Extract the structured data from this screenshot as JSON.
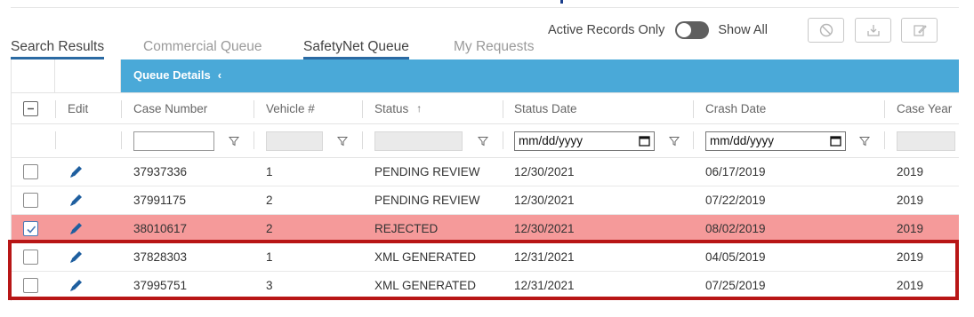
{
  "tabs": [
    {
      "label": "Search Results",
      "active": true
    },
    {
      "label": "Commercial Queue",
      "active": false
    },
    {
      "label": "SafetyNet Queue",
      "active": true
    },
    {
      "label": "My Requests",
      "active": false
    }
  ],
  "toolbar": {
    "active_only_label": "Active Records Only",
    "show_all_label": "Show All",
    "buttons": [
      "block-icon",
      "download-icon",
      "edit-icon"
    ]
  },
  "grid": {
    "panel_label": "Queue Details",
    "columns": {
      "edit": "Edit",
      "case_number": "Case Number",
      "vehicle": "Vehicle #",
      "status": "Status",
      "status_date": "Status Date",
      "crash_date": "Crash Date",
      "case_year": "Case Year"
    },
    "sort_indicator": "↑",
    "filters": {
      "status_date_placeholder": "mm/dd/yyyy",
      "crash_date_placeholder": "mm/dd/yyyy"
    },
    "rows": [
      {
        "case_number": "37937336",
        "vehicle": "1",
        "status": "PENDING REVIEW",
        "status_date": "12/30/2021",
        "crash_date": "06/17/2019",
        "case_year": "2019",
        "checked": false,
        "highlight": ""
      },
      {
        "case_number": "37991175",
        "vehicle": "2",
        "status": "PENDING REVIEW",
        "status_date": "12/30/2021",
        "crash_date": "07/22/2019",
        "case_year": "2019",
        "checked": false,
        "highlight": ""
      },
      {
        "case_number": "38010617",
        "vehicle": "2",
        "status": "REJECTED",
        "status_date": "12/30/2021",
        "crash_date": "08/02/2019",
        "case_year": "2019",
        "checked": true,
        "highlight": "#f59a9a"
      },
      {
        "case_number": "37828303",
        "vehicle": "1",
        "status": "XML GENERATED",
        "status_date": "12/31/2021",
        "crash_date": "04/05/2019",
        "case_year": "2019",
        "checked": false,
        "highlight": ""
      },
      {
        "case_number": "37995751",
        "vehicle": "3",
        "status": "XML GENERATED",
        "status_date": "12/31/2021",
        "crash_date": "07/25/2019",
        "case_year": "2019",
        "checked": false,
        "highlight": ""
      }
    ]
  },
  "colors": {
    "accent_blue": "#4aa9d8",
    "tab_underline": "#2b6aa3",
    "rejected_row": "#f59a9a",
    "annotation_box": "#b81616",
    "edit_icon": "#1f5f9f"
  }
}
